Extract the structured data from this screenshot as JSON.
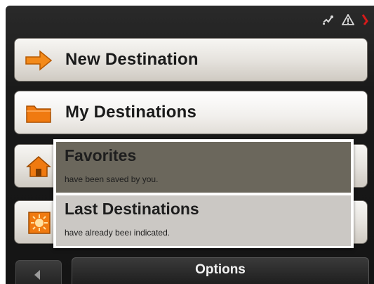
{
  "status_bar": {
    "icons": [
      "gps-signal-icon",
      "warning-triangle-icon",
      "battery-icon"
    ]
  },
  "menu": {
    "new_destination": {
      "label": "New Destination",
      "icon": "arrow-right-icon"
    },
    "my_destinations": {
      "label": "My Destinations",
      "icon": "folder-icon"
    },
    "home": {
      "label": "",
      "icon": "home-icon"
    },
    "last": {
      "label": "",
      "icon": "sun-icon"
    }
  },
  "popup": {
    "items": [
      {
        "title": "Favorites",
        "subtitle": "have been saved by you."
      },
      {
        "title": "Last Destinations",
        "subtitle": "have already beeı indicated."
      }
    ]
  },
  "bottom_bar": {
    "back_icon": "chevron-left-icon",
    "options_label": "Options"
  },
  "colors": {
    "accent_orange": "#f07a10",
    "favorites_bg": "#6b675c",
    "last_bg": "#cbc8c4"
  }
}
